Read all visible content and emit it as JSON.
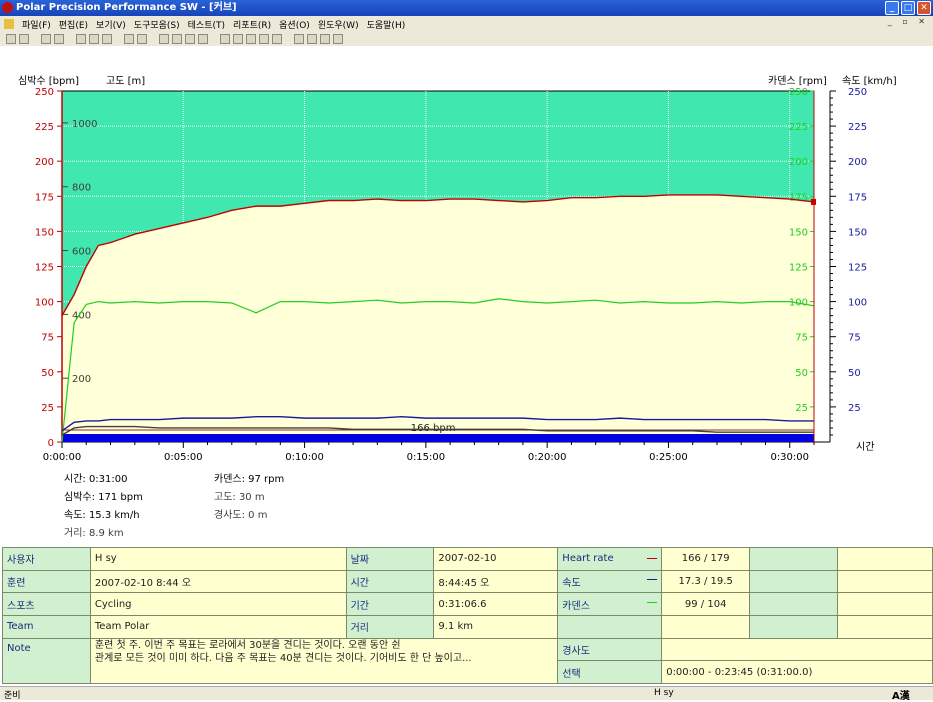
{
  "window": {
    "title": "Polar Precision Performance SW - [커브]"
  },
  "menu": [
    "파일(F)",
    "편집(E)",
    "보기(V)",
    "도구모음(S)",
    "테스트(T)",
    "리포트(R)",
    "옵션(O)",
    "윈도우(W)",
    "도움말(H)"
  ],
  "colors": {
    "heart": "#c00000",
    "altitude": "#404040",
    "cadence": "#22cc22",
    "speed": "#1a1aa0",
    "bg_green": "#40e8b0",
    "bg_yellow": "#ffffd8",
    "bar": "#0000e0"
  },
  "chart": {
    "left_label_hr": "심박수 [bpm]",
    "left_label_alt": "고도 [m]",
    "right_label_cad": "카덴스 [rpm]",
    "right_label_speed": "속도 [km/h]",
    "x_label": "시간",
    "hr_ticks": [
      "250",
      "225",
      "200",
      "175",
      "150",
      "125",
      "100",
      "75",
      "50",
      "25",
      "0"
    ],
    "alt_ticks": [
      "1000",
      "800",
      "600",
      "400",
      "200"
    ],
    "cad_ticks": [
      "250",
      "225",
      "200",
      "175",
      "150",
      "125",
      "100",
      "75",
      "50",
      "25"
    ],
    "speed_ticks": [
      "250",
      "225",
      "200",
      "175",
      "150",
      "125",
      "100",
      "75",
      "50",
      "25"
    ],
    "x_ticks": [
      "0:00:00",
      "0:05:00",
      "0:10:00",
      "0:15:00",
      "0:20:00",
      "0:25:00",
      "0:30:00"
    ],
    "limit_label": "166 bpm"
  },
  "chart_data": {
    "type": "line",
    "x_unit": "minutes",
    "xlim": [
      0,
      31
    ],
    "x": [
      0,
      0.5,
      1,
      1.5,
      2,
      3,
      4,
      5,
      6,
      7,
      8,
      9,
      10,
      11,
      12,
      13,
      14,
      15,
      16,
      17,
      18,
      19,
      20,
      21,
      22,
      23,
      24,
      25,
      26,
      27,
      28,
      29,
      30,
      31
    ],
    "series": [
      {
        "name": "심박수",
        "axis": "hr",
        "values": [
          90,
          105,
          125,
          140,
          142,
          148,
          152,
          156,
          160,
          165,
          168,
          168,
          170,
          172,
          172,
          173,
          172,
          172,
          173,
          173,
          172,
          171,
          172,
          174,
          174,
          175,
          175,
          176,
          176,
          176,
          175,
          174,
          173,
          171
        ]
      },
      {
        "name": "카덴스",
        "axis": "hr",
        "values": [
          0,
          85,
          98,
          100,
          99,
          100,
          99,
          100,
          100,
          99,
          92,
          100,
          100,
          99,
          100,
          101,
          99,
          100,
          100,
          99,
          102,
          100,
          99,
          100,
          101,
          99,
          100,
          99,
          99,
          100,
          99,
          100,
          100,
          97
        ]
      },
      {
        "name": "속도",
        "axis": "hr",
        "values": [
          8,
          14,
          15,
          15,
          16,
          16,
          16,
          17,
          17,
          17,
          18,
          18,
          17,
          17,
          17,
          17,
          18,
          17,
          17,
          17,
          17,
          17,
          16,
          16,
          16,
          17,
          16,
          16,
          16,
          16,
          16,
          16,
          15,
          15
        ]
      },
      {
        "name": "고도",
        "axis": "hr",
        "values": [
          5,
          10,
          11,
          11,
          11,
          11,
          10,
          10,
          10,
          10,
          10,
          10,
          10,
          10,
          9,
          9,
          9,
          9,
          9,
          9,
          9,
          9,
          8,
          8,
          8,
          8,
          8,
          8,
          8,
          7,
          7,
          7,
          7,
          7
        ]
      }
    ],
    "hr_limit": 166,
    "ylim": [
      0,
      250
    ],
    "alt_range": [
      0,
      1100
    ],
    "selection": [
      "0:00:00",
      "0:31:00"
    ]
  },
  "readout": {
    "time": "시간: 0:31:00",
    "cadence": "카덴스: 97 rpm",
    "heart": "심박수: 171 bpm",
    "altitude": "고도: 30 m",
    "speed": "속도: 15.3 km/h",
    "incline": "경사도: 0 m",
    "distance": "거리: 8.9 km"
  },
  "info": {
    "user_label": "사용자",
    "user_value": "H sy",
    "date_label": "날짜",
    "date_value": "2007-02-10",
    "hr_label": "Heart rate",
    "hr_value": "166 / 179",
    "exercise_label": "훈련",
    "exercise_value": "2007-02-10 8:44 오",
    "time_label": "시간",
    "time_value": "8:44:45 오",
    "speed_label": "속도",
    "speed_value": "17.3 / 19.5",
    "sport_label": "스포츠",
    "sport_value": "Cycling",
    "duration_label": "기간",
    "duration_value": "0:31:06.6",
    "cadence_label": "카덴스",
    "cadence_value": "99 / 104",
    "team_label": "Team",
    "team_value": "Team Polar",
    "distance_label": "거리",
    "distance_value": "9.1 km",
    "note_label": "Note",
    "note_line1": "훈련 첫 주. 이번 주 목표는 로라에서 30분을 견디는 것이다. 오랜 동안 쉰",
    "note_line2": "관계로 모든 것이 미미 하다. 다음 주 목표는 40분 견디는 것이다. 기어비도 한 단 높이고...",
    "incline_label": "경사도",
    "incline_value": "",
    "selection_label": "선택",
    "selection_value": "0:00:00 - 0:23:45 (0:31:00.0)"
  },
  "status": {
    "left": "준비",
    "center": "H sy",
    "ime": "A漢"
  }
}
